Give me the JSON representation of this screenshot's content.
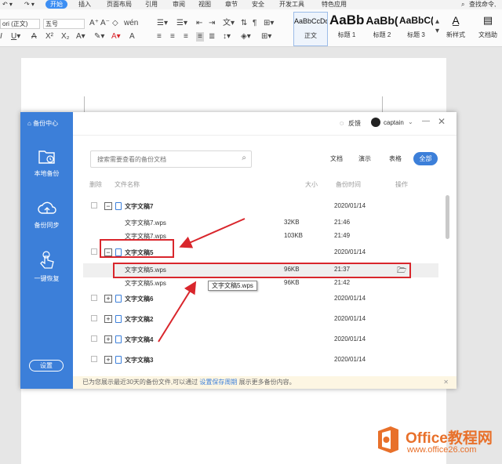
{
  "ribbon": {
    "tabs": [
      "开始",
      "插入",
      "页面布局",
      "引用",
      "审阅",
      "视图",
      "章节",
      "安全",
      "开发工具",
      "特色应用"
    ],
    "active_tab": "开始",
    "search_label": "查找命令,",
    "font_name": "ori (正文)",
    "font_size": "五号",
    "styles": [
      {
        "sample": "AaBbCcDd",
        "label": "正文"
      },
      {
        "sample": "AaBb",
        "label": "标题 1"
      },
      {
        "sample": "AaBb(",
        "label": "标题 2"
      },
      {
        "sample": "AaBbC(",
        "label": "标题 3"
      }
    ],
    "new_style_label": "新样式",
    "text_tools_label": "文档助"
  },
  "dialog": {
    "brand": "备份中心",
    "feedback": "反馈",
    "username": "captain",
    "sidebar": [
      {
        "icon": "folder-clock-icon",
        "label": "本地备份"
      },
      {
        "icon": "cloud-upload-icon",
        "label": "备份同步"
      },
      {
        "icon": "hand-touch-icon",
        "label": "一键恢复"
      }
    ],
    "settings_label": "设置",
    "search_placeholder": "搜索需要查看的备份文档",
    "filter_tabs": [
      "文档",
      "演示",
      "表格",
      "全部"
    ],
    "active_filter": "全部",
    "columns": {
      "delete": "删除",
      "name": "文件名称",
      "size": "大小",
      "time": "备份时间",
      "action": "操作"
    },
    "rows": [
      {
        "type": "group",
        "name": "文字文稿7",
        "time": "2020/01/14",
        "expanded": true
      },
      {
        "type": "file",
        "name": "文字文稿7.wps",
        "size": "32KB",
        "time": "21:46"
      },
      {
        "type": "file",
        "name": "文字文稿7.wps",
        "size": "103KB",
        "time": "21:49"
      },
      {
        "type": "group",
        "name": "文字文稿5",
        "time": "2020/01/14",
        "expanded": true
      },
      {
        "type": "file",
        "name": "文字文稿5.wps",
        "size": "96KB",
        "time": "21:37",
        "selected": true
      },
      {
        "type": "file",
        "name": "文字文稿5.wps",
        "size": "96KB",
        "time": "21:42"
      },
      {
        "type": "group",
        "name": "文字文稿6",
        "time": "2020/01/14",
        "expanded": false
      },
      {
        "type": "group",
        "name": "文字文稿2",
        "time": "2020/01/14",
        "expanded": false
      },
      {
        "type": "group",
        "name": "文字文稿4",
        "time": "2020/01/14",
        "expanded": false
      },
      {
        "type": "group",
        "name": "文字文稿3",
        "time": "2020/01/14",
        "expanded": false
      }
    ],
    "tooltip": "文字文稿5.wps",
    "footer_text": "已为您展示最近30天的备份文件,可以通过",
    "footer_link": "设置保存周期",
    "footer_tail": "展示更多备份内容。"
  },
  "watermark": {
    "title": "Office教程网",
    "url": "www.office26.com"
  },
  "colors": {
    "accent": "#3c7fd9",
    "highlight": "#d9262c",
    "brand_orange": "#e8702a"
  }
}
